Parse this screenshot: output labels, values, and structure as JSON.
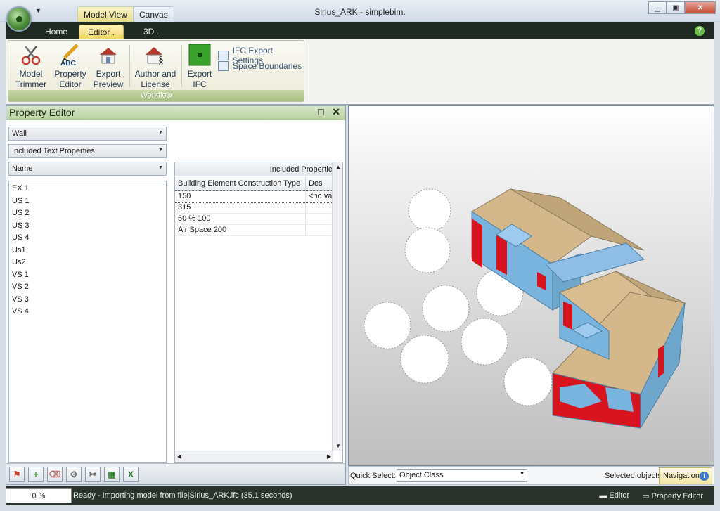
{
  "window": {
    "title": "Sirius_ARK - simplebim."
  },
  "context_tabs": {
    "model_view": "Model View",
    "canvas": "Canvas"
  },
  "ribbon_tabs": {
    "home": "Home",
    "editor": "Editor",
    "three_d": "3D"
  },
  "ribbon": {
    "group_label": "Workflow",
    "buttons": {
      "model_trimmer": [
        "Model",
        "Trimmer"
      ],
      "property_editor": [
        "Property",
        "Editor"
      ],
      "export_preview": [
        "Export",
        "Preview"
      ],
      "author_license": [
        "Author and",
        "License"
      ],
      "export_ifc": [
        "Export",
        "IFC"
      ]
    },
    "small": {
      "ifc_export_settings": "IFC Export Settings",
      "space_boundaries": "Space Boundaries"
    },
    "abc_text": "ABC"
  },
  "property_editor": {
    "title": "Property Editor",
    "combos": {
      "element_class": "Wall",
      "property_set": "Included Text Properties",
      "group_by": "Name"
    },
    "items": [
      "EX 1",
      "US 1",
      "US 2",
      "US 3",
      "US 4",
      "Us1",
      "Us2",
      "VS 1",
      "VS 2",
      "VS 3",
      "VS 4"
    ],
    "grid": {
      "top_header": "Included Propertie",
      "columns": [
        "Building Element Construction Type",
        "Des"
      ],
      "rows": [
        [
          "150",
          "<no val"
        ],
        [
          "315",
          ""
        ],
        [
          "50 % 100",
          ""
        ],
        [
          "Air Space 200",
          ""
        ]
      ]
    }
  },
  "viewport_footer": {
    "quick_select_label": "Quick Select:",
    "quick_select_value": "Object Class",
    "selected_objects": "Selected objects",
    "navigation": "Navigation"
  },
  "statusbar": {
    "progress": "0 %",
    "message": "Ready - Importing model from file|Sirius_ARK.ifc  (35.1 seconds)",
    "right_editor": "Editor",
    "right_property_editor": "Property Editor"
  }
}
